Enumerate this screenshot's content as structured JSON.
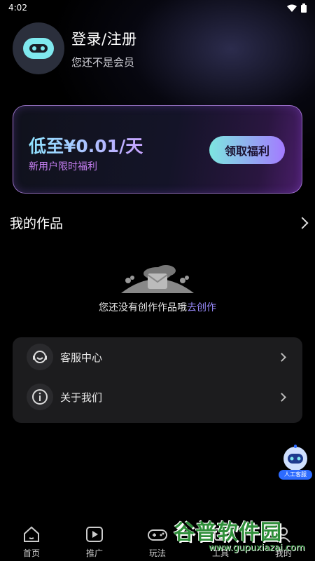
{
  "status_bar": {
    "time": "4:02"
  },
  "profile": {
    "title": "登录/注册",
    "subtitle": "您还不是会员"
  },
  "vip_card": {
    "price": "低至¥0.01/天",
    "subtitle": "新用户限时福利",
    "button": "领取福利"
  },
  "works": {
    "title": "我的作品",
    "empty_text": "您还没有创作作品哦",
    "empty_link": "去创作"
  },
  "menu": [
    {
      "label": "客服中心",
      "icon": "headset-icon"
    },
    {
      "label": "关于我们",
      "icon": "info-icon"
    }
  ],
  "floating_service": {
    "label": "人工客服"
  },
  "tabs": [
    {
      "label": "首页",
      "icon": "home-icon"
    },
    {
      "label": "推广",
      "icon": "play-icon"
    },
    {
      "label": "玩法",
      "icon": "gamepad-icon"
    },
    {
      "label": "工具",
      "icon": "tool-icon"
    },
    {
      "label": "我的",
      "icon": "user-icon"
    }
  ],
  "watermark": {
    "brand": "谷普软件园",
    "url": "www.gupuxiazai.com"
  },
  "colors": {
    "accent": "#9b8cff",
    "card_border": "#c896ff"
  }
}
